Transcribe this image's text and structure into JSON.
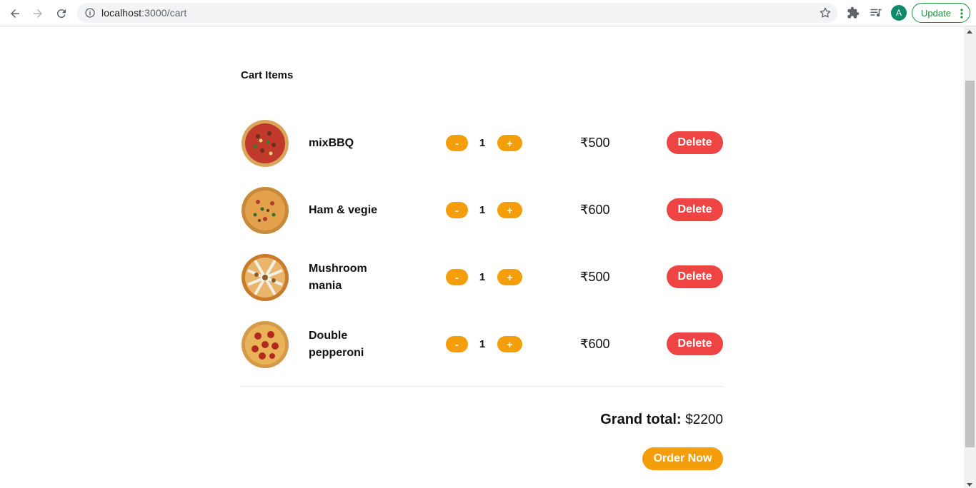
{
  "browser": {
    "url_host": "localhost",
    "url_path": ":3000/cart",
    "avatar_letter": "A",
    "update_label": "Update"
  },
  "cart": {
    "title": "Cart Items",
    "items": [
      {
        "name": "mixBBQ",
        "qty": "1",
        "price": "₹500",
        "minus": "-",
        "plus": "+",
        "delete": "Delete",
        "image": "pizza-bbq"
      },
      {
        "name": "Ham & vegie",
        "qty": "1",
        "price": "₹600",
        "minus": "-",
        "plus": "+",
        "delete": "Delete",
        "image": "pizza-ham-vegie"
      },
      {
        "name": "Mushroom mania",
        "qty": "1",
        "price": "₹500",
        "minus": "-",
        "plus": "+",
        "delete": "Delete",
        "image": "pizza-mushroom"
      },
      {
        "name": "Double pepperoni",
        "qty": "1",
        "price": "₹600",
        "minus": "-",
        "plus": "+",
        "delete": "Delete",
        "image": "pizza-pepperoni"
      }
    ],
    "grand_total_label": "Grand total:",
    "grand_total_value": "$2200",
    "order_label": "Order Now"
  },
  "colors": {
    "accent": "#f59e0b",
    "danger": "#ef4444",
    "update_green": "#1e8e3e"
  }
}
